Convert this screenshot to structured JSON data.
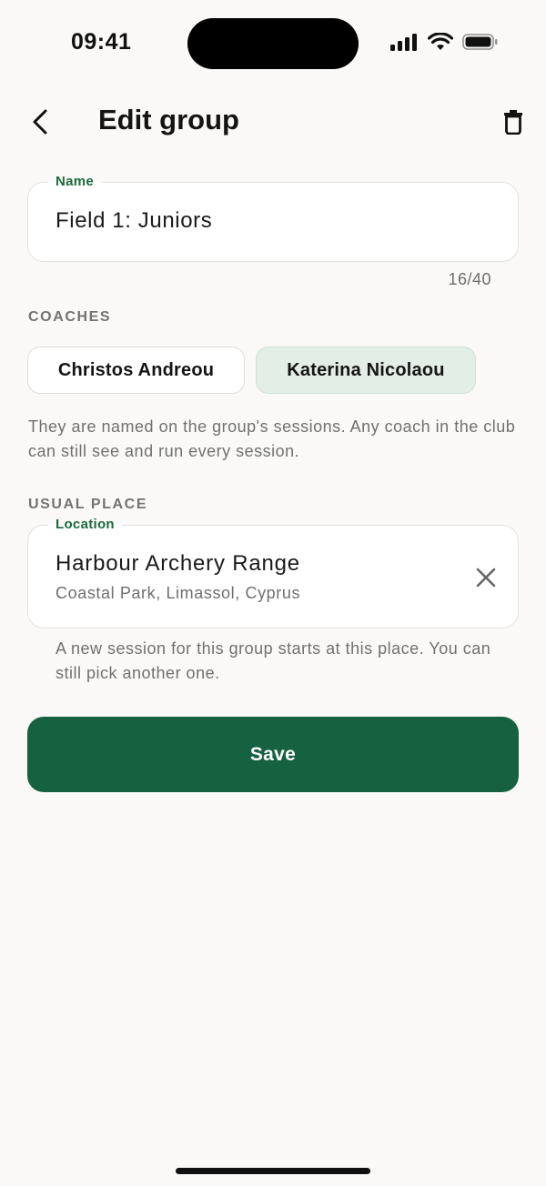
{
  "status_bar": {
    "time": "09:41",
    "icons": [
      "signal-icon",
      "wifi-icon",
      "battery-icon"
    ]
  },
  "header": {
    "title": "Edit group",
    "back_icon": "chevron-left-icon",
    "delete_icon": "trash-icon"
  },
  "name_field": {
    "label": "Name",
    "value": "Field 1: Juniors",
    "counter": "16/40"
  },
  "coaches": {
    "label": "COACHES",
    "chips": [
      {
        "name": "Christos Andreou",
        "selected": false
      },
      {
        "name": "Katerina Nicolaou",
        "selected": true
      }
    ],
    "help": "They are named on the group's sessions. Any coach in the club can still see and run every session."
  },
  "usual_place": {
    "label": "USUAL PLACE",
    "field_label": "Location",
    "title": "Harbour Archery Range",
    "subtitle": "Coastal Park, Limassol, Cyprus",
    "clear_icon": "close-icon",
    "help": "A new session for this group starts at this place. You can still pick another one."
  },
  "actions": {
    "save_label": "Save"
  },
  "colors": {
    "accent": "#156140",
    "accent_text": "#1c6a3f",
    "chip_selected_bg": "#e3eee6",
    "background": "#faf9f7"
  }
}
